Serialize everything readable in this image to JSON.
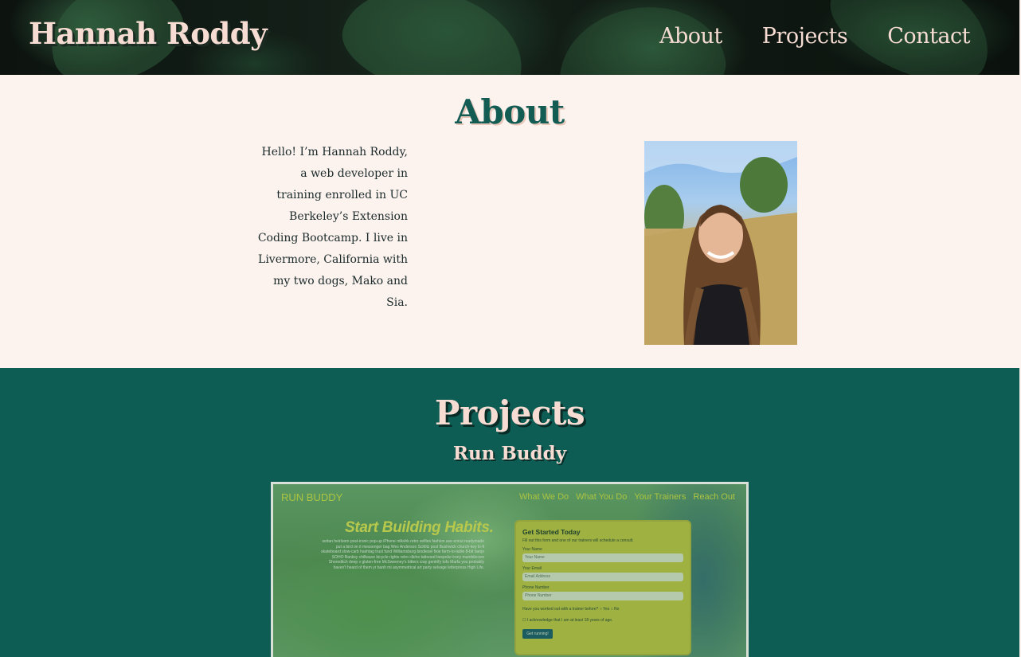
{
  "header": {
    "brand": "Hannah Roddy",
    "nav": [
      "About",
      "Projects",
      "Contact"
    ]
  },
  "about": {
    "title": "About",
    "text": "Hello! I’m Hannah Roddy, a web developer in training enrolled in UC Berkeley’s Extension Coding Bootcamp. I live in Livermore, California with my two dogs, Mako and Sia."
  },
  "projects": {
    "title": "Projects",
    "project_name": "Run Buddy",
    "screenshot": {
      "brand": "RUN BUDDY",
      "nav": [
        "What We Do",
        "What You Do",
        "Your Trainers",
        "Reach Out"
      ],
      "hero": "Start Building Habits.",
      "lorem": "seitan heirloom post-ironic pop-up iPhone mlkshk retro selfies fashion axe ennui readymade put a bird on it messenger bag Wes Anderson Schlitz post Bushwick church-key lo-fi skateboard slow-carb hashtag trust fund Williamsburg biodiesel fixie farm-to-table 8-bit banjo SOHO Banksy chillwave bicycle rights retro cliche tattooed bespoke irony mumblecore Shoreditch deep v gluten-free McSweeney's bitters cray gentrify tofu Marfa you probably haven't heard of them yr banh mi asymmetrical art party selvage letterpress High Life.",
      "form": {
        "title": "Get Started Today",
        "subtitle": "Fill out this form and one of our trainers will schedule a consult.",
        "name_label": "Your Name",
        "name_placeholder": "Your Name",
        "email_label": "Your Email",
        "email_placeholder": "Email Address",
        "phone_label": "Phone Number",
        "phone_placeholder": "Phone Number",
        "question": "Have you worked out with a trainer before?",
        "yes": "Yes",
        "no": "No",
        "checkbox": "I acknowledge that I am at least 18 years of age.",
        "button": "Get running!"
      }
    }
  },
  "colors": {
    "accent_teal": "#0d5d55",
    "title_teal": "#125c54",
    "cream": "#fcf2ee",
    "pink_text": "#f6dcd2"
  }
}
